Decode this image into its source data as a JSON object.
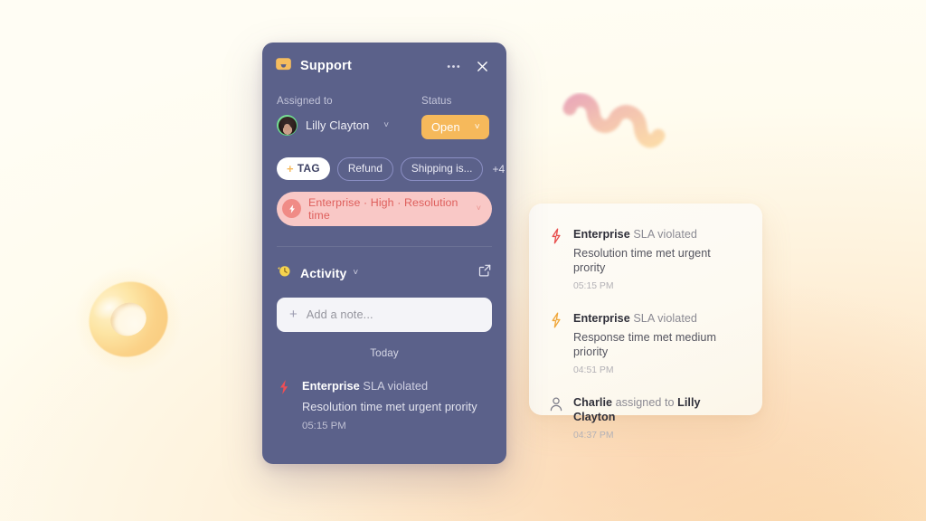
{
  "background": {
    "gradient_from": "#fffdf2",
    "gradient_to": "#fbdcb0",
    "torus_color": "#fbd288",
    "squiggle_from": "#eaa8b4",
    "squiggle_to": "#f8d3a4"
  },
  "panel": {
    "title": "Support",
    "icon": "inbox-icon",
    "more_label": "•••",
    "close_label": "✕",
    "background": "#5b618a",
    "assignee": {
      "label": "Assigned to",
      "name": "Lilly Clayton",
      "chevron": "˅"
    },
    "status": {
      "label": "Status",
      "value": "Open",
      "chevron": "˅",
      "color": "#f6b95b"
    },
    "tags": {
      "add_tag": "TAG",
      "add_tag_plus": "+",
      "items": [
        "Refund",
        "Shipping is..."
      ],
      "overflow": "+4"
    },
    "priority": {
      "text": "Enterprise · High · Resolution time",
      "chevron": "˅",
      "background": "#f9c8c6",
      "text_color": "#de5f5c"
    },
    "activity": {
      "title": "Activity",
      "chevron": "˅",
      "icon": "activity-history-icon",
      "expand_icon": "external-link-icon",
      "note_placeholder": "Add a note...",
      "note_plus": "+",
      "day_label": "Today",
      "entry": {
        "icon": "lightning-bolt-icon",
        "actor": "Enterprise",
        "action": "SLA violated",
        "detail": "Resolution time met urgent prority",
        "time": "05:15 PM"
      }
    }
  },
  "feed": {
    "items": [
      {
        "icon": "lightning-bolt-icon",
        "icon_color": "#e8504f",
        "actor": "Enterprise",
        "action": "SLA violated",
        "detail": "Resolution time met urgent prority",
        "time": "05:15 PM"
      },
      {
        "icon": "lightning-bolt-icon",
        "icon_color": "#f0a73c",
        "actor": "Enterprise",
        "action": "SLA violated",
        "detail": "Response time met medium priority",
        "time": "04:51 PM"
      },
      {
        "icon": "user-icon",
        "icon_color": "#7c7c88",
        "actor": "Charlie",
        "action": "assigned to",
        "detail": "Lilly Clayton",
        "time": "04:37 PM"
      }
    ]
  }
}
